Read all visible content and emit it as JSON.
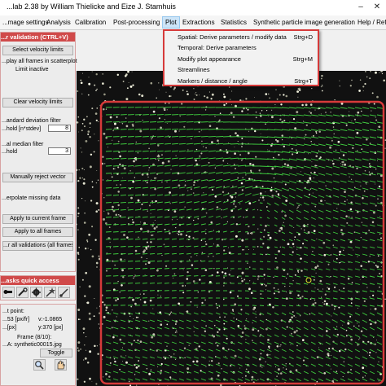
{
  "window": {
    "title": "...lab 2.38 by William Thielicke and Eize J. Stamhuis",
    "minimize_icon": "minimize-icon",
    "close_icon": "close-icon"
  },
  "menubar": {
    "items": [
      "...mage settings",
      "Analysis",
      "Calibration",
      "Post-processing",
      "Plot",
      "Extractions",
      "Statistics",
      "Synthetic particle image generation",
      "Help / Refe..."
    ]
  },
  "plot_menu": {
    "items": [
      {
        "label": "Spatial: Derive parameters / modify data",
        "shortcut": "Strg+D"
      },
      {
        "label": "Temporal: Derive parameters",
        "shortcut": ""
      },
      {
        "label": "Modify plot appearance",
        "shortcut": "Strg+M"
      },
      {
        "label": "Streamlines",
        "shortcut": ""
      },
      {
        "label": "Markers / distance / angle",
        "shortcut": "Strg+T"
      }
    ]
  },
  "validation_panel": {
    "header": "...r validation (CTRL+V)",
    "select_velocity_limits": "Select velocity limits",
    "display_all_frames": "...play all frames in scatterplot",
    "limit_status": "Limit inactive",
    "clear_velocity_limits": "Clear velocity limits",
    "std_filter_label1": "...andard deviation filter",
    "std_filter_label2": "...hold [n*stdev]",
    "std_filter_value": "8",
    "median_filter_label1": "...al median filter",
    "median_filter_label2": "...hold",
    "median_filter_value": "3",
    "manually_reject": "Manually reject vector",
    "interpolate_missing": "...erpolate missing data",
    "apply_current": "Apply to current frame",
    "apply_all": "Apply to all frames",
    "clear_all": "...r all validations (all frames)"
  },
  "tasks_panel": {
    "header": "...asks quick access",
    "icons": [
      "run-icon",
      "wrench-icon",
      "gear-icon",
      "magic-wand-icon",
      "brush-icon"
    ]
  },
  "info_panel": {
    "point_label": "...t point:",
    "u_text": "...53 [px/fr]",
    "v_text": "v:-1.0865",
    "x_text": "...[px]",
    "y_text": "y:370 [px]",
    "frame_text": "Frame (8/10):",
    "file_text": "...A: synthetic00015.jpg",
    "toggle_label": "Toggle",
    "zoom_icon": "zoom-icon",
    "pan_icon": "pan-hand-icon"
  },
  "colors": {
    "accent_red": "#d63a3a",
    "vector_green": "#3fcc3f",
    "plot_background": "#111111"
  }
}
